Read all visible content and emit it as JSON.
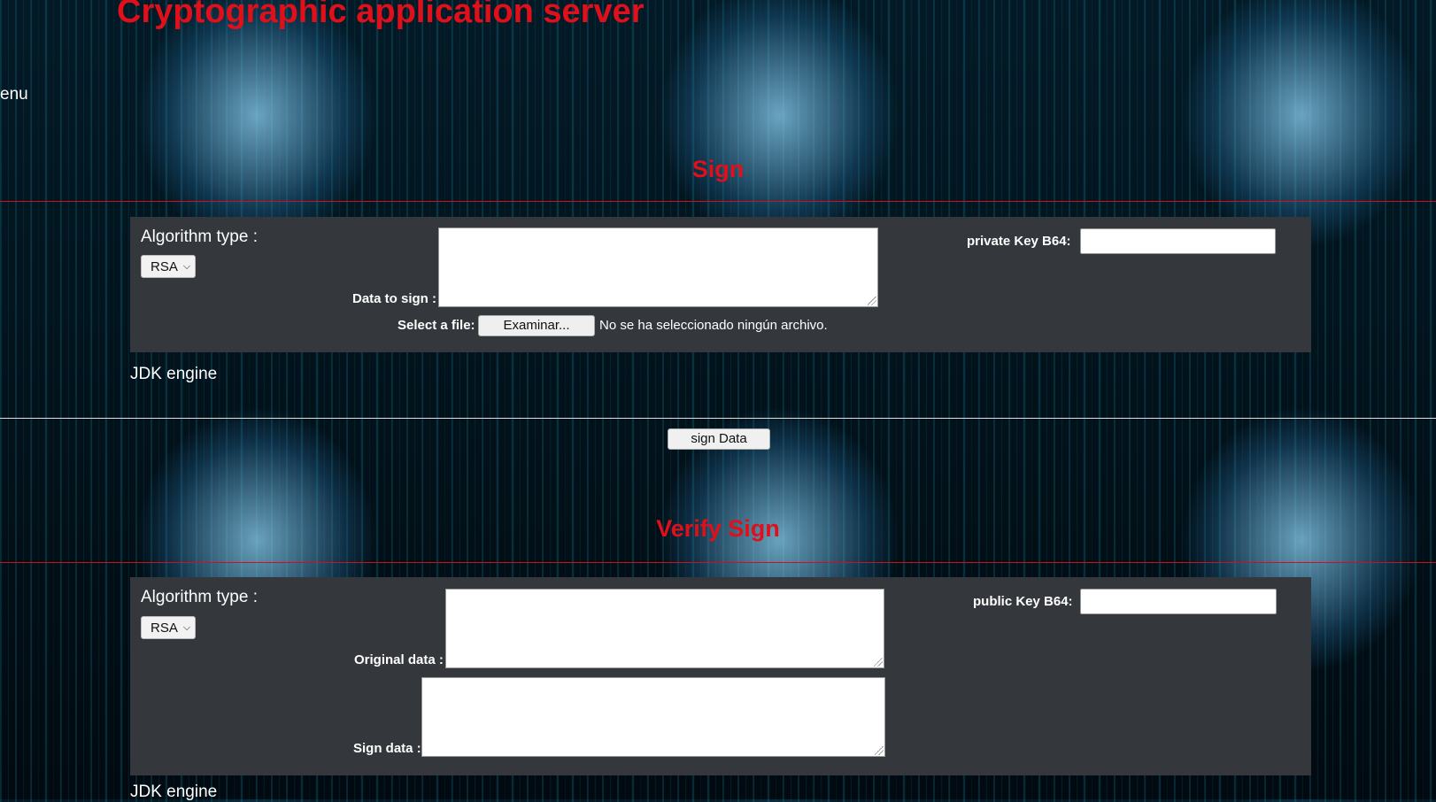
{
  "page": {
    "title": "Cryptographic application server",
    "menu_label": "enu"
  },
  "sign": {
    "section_title": "Sign",
    "algorithm_label": "Algorithm type :",
    "algorithm_selected": "RSA",
    "data_label": "Data to sign :",
    "data_value": "",
    "key_label": "private Key B64:",
    "key_value": "",
    "file_label": "Select a file:",
    "browse_label": "Examinar...",
    "file_status": "No se ha seleccionado ningún archivo.",
    "engine_label": "JDK engine",
    "submit_label": "sign Data"
  },
  "verify": {
    "section_title": "Verify Sign",
    "algorithm_label": "Algorithm type :",
    "algorithm_selected": "RSA",
    "original_label": "Original data :",
    "original_value": "",
    "sign_label": "Sign data :",
    "sign_value": "",
    "key_label": "public Key B64:",
    "key_value": "",
    "engine_label": "JDK engine"
  },
  "colors": {
    "accent_red": "#e00f1a",
    "panel_bg": "#34373c"
  }
}
